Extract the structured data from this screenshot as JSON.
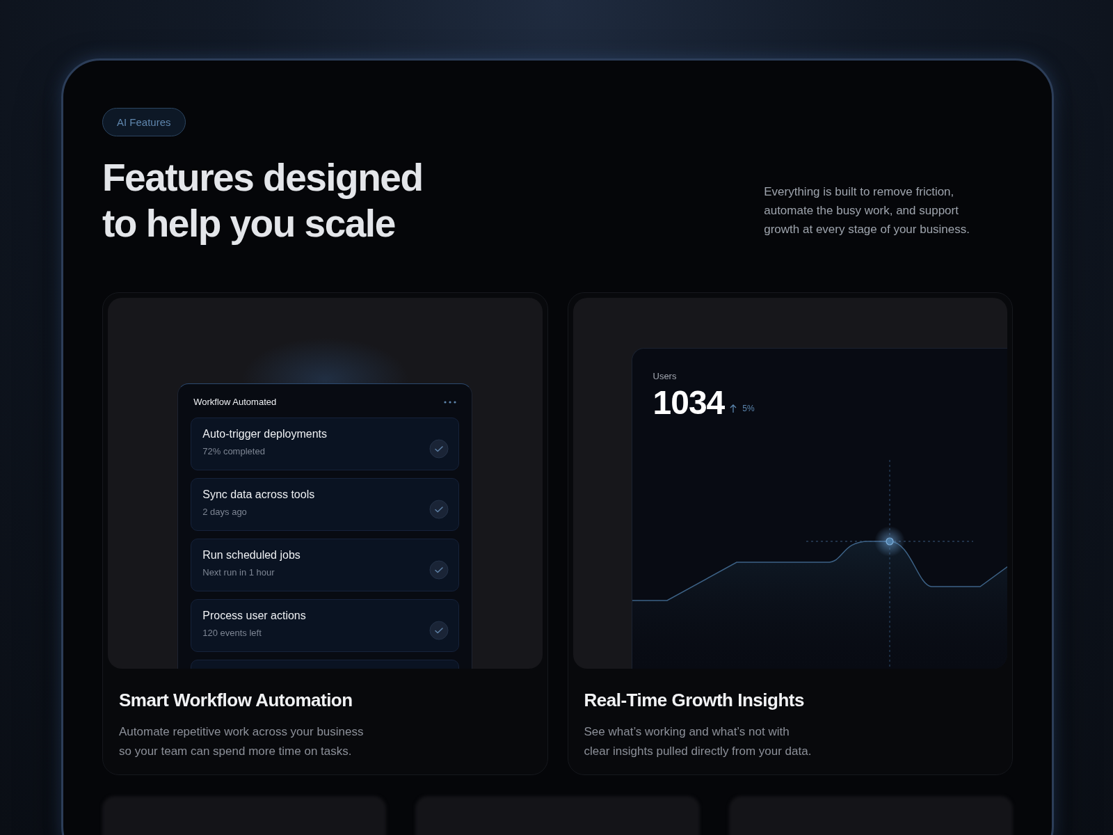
{
  "badge": "AI Features",
  "heading": [
    "Features designed",
    "to help you scale"
  ],
  "intro": [
    "Everything is built to remove friction,",
    "automate the busy work, and support",
    "growth at every stage of your business."
  ],
  "cards": [
    {
      "kind": "workflow",
      "title": "Smart Workflow Automation",
      "description": [
        "Automate repetitive work across your business",
        "so your team can spend more time on tasks."
      ],
      "panel": {
        "title": "Workflow Automated",
        "items": [
          {
            "name": "Auto-trigger deployments",
            "detail": "72% completed",
            "done": true
          },
          {
            "name": "Sync data across tools",
            "detail": "2 days ago",
            "done": true
          },
          {
            "name": "Run scheduled jobs",
            "detail": "Next run in 1 hour",
            "done": true
          },
          {
            "name": "Process user actions",
            "detail": "120 events left",
            "done": true
          }
        ]
      }
    },
    {
      "kind": "metric",
      "title": "Real-Time Growth Insights",
      "description": [
        "See what’s working and what’s not with",
        "clear insights pulled directly from your data."
      ],
      "panel": {
        "label": "Users",
        "value": "1034",
        "change": "5%"
      }
    }
  ]
}
